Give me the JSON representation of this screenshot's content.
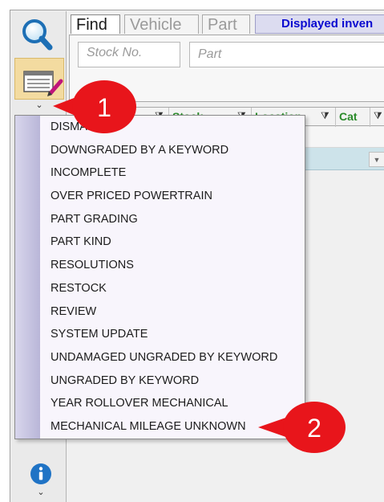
{
  "tabs": [
    {
      "label": "Find"
    },
    {
      "label": "Vehicle"
    },
    {
      "label": "Part"
    }
  ],
  "header": {
    "displayed_inventory": "Displayed inven"
  },
  "search": {
    "stock_placeholder": "Stock No.",
    "part_placeholder": "Part"
  },
  "grid": {
    "columns": [
      {
        "label": "Stock"
      },
      {
        "label": "Location"
      },
      {
        "label": "Cat"
      }
    ]
  },
  "dropdown": {
    "items": [
      {
        "label": "DISMANTLE"
      },
      {
        "label": "DOWNGRADED BY A KEYWORD"
      },
      {
        "label": "INCOMPLETE"
      },
      {
        "label": "OVER PRICED POWERTRAIN"
      },
      {
        "label": "PART GRADING"
      },
      {
        "label": "PART KIND"
      },
      {
        "label": "RESOLUTIONS"
      },
      {
        "label": "RESTOCK"
      },
      {
        "label": "REVIEW"
      },
      {
        "label": "SYSTEM UPDATE"
      },
      {
        "label": "UNDAMAGED UNGRADED BY KEYWORD"
      },
      {
        "label": "UNGRADED BY KEYWORD"
      },
      {
        "label": "YEAR ROLLOVER MECHANICAL"
      },
      {
        "label": "MECHANICAL MILEAGE UNKNOWN"
      }
    ]
  },
  "callouts": [
    {
      "number": "1"
    },
    {
      "number": "2"
    }
  ],
  "icons": {
    "search": "search-icon",
    "edit": "edit-list-icon",
    "info": "info-icon",
    "chevron": "chevron-down-icon",
    "filter": "filter-icon"
  },
  "colors": {
    "accent_blue": "#0a0ad0",
    "column_green": "#2a8a2a",
    "callout_red": "#e8151b",
    "edit_highlight": "#f3dba0",
    "selected_row": "#cde3ea",
    "info_blue": "#1f73c5"
  }
}
